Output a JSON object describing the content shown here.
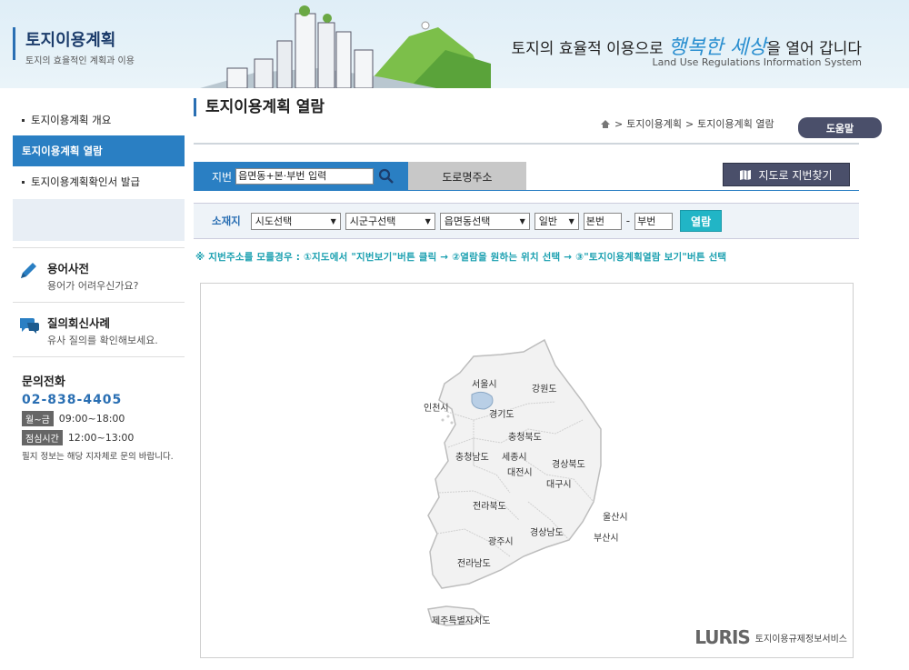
{
  "header": {
    "brand_title": "토지이용계획",
    "brand_sub": "토지의 효율적인 계획과 이용",
    "slogan_pre": "토지의 효율적 이용으로 ",
    "slogan_hl": "행복한 세상",
    "slogan_post": "을 열어 갑니다",
    "slogan_en": "Land Use Regulations Information System"
  },
  "sidebar": {
    "items": [
      {
        "label": "토지이용계획 개요"
      },
      {
        "label": "토지이용계획 열람"
      },
      {
        "label": "토지이용계획확인서 발급"
      }
    ],
    "dictionary": {
      "title": "용어사전",
      "sub": "용어가 어려우신가요?"
    },
    "qa": {
      "title": "질의회신사례",
      "sub": "유사 질의를 확인해보세요."
    },
    "contact": {
      "label": "문의전화",
      "phone": "02-838-4405",
      "weekday_tag": "월~금",
      "weekday_time": "09:00~18:00",
      "lunch_tag": "점심시간",
      "lunch_time": "12:00~13:00",
      "note": "필지 정보는 해당 지자체로 문의 바랍니다."
    }
  },
  "main": {
    "title": "토지이용계획 열람",
    "breadcrumb": [
      "토지이용계획",
      "토지이용계획 열람"
    ],
    "help": "도움말",
    "tab_jibun": "지번",
    "jibun_placeholder": "읍면동+본·부번 입력",
    "tab_road": "도로명주소",
    "map_find": "지도로 지번찾기",
    "filter": {
      "label": "소재지",
      "sido": "시도선택",
      "sigungu": "시군구선택",
      "eupmyeon": "읍면동선택",
      "type": "일반",
      "bonbun": "본번",
      "dash": "-",
      "bubun": "부번",
      "view": "열람"
    },
    "guide": "※ 지번주소를 모를경우 : ①지도에서 \"지번보기\"버튼 클릭 → ②열람을 원하는 위치 선택 → ③\"토지이용계획열람 보기\"버튼 선택",
    "map": {
      "regions": [
        "서울시",
        "강원도",
        "인천시",
        "경기도",
        "충청북도",
        "충청남도",
        "세종시",
        "대전시",
        "경상북도",
        "대구시",
        "전라북도",
        "울산시",
        "광주시",
        "경상남도",
        "부산시",
        "전라남도",
        "제주특별자치도"
      ],
      "logo": "LURIS",
      "service": "토지이용규제정보서비스"
    }
  },
  "colors": {
    "primary": "#2a7fc3",
    "dark_button": "#4a4f6a",
    "teal": "#21b5c6"
  }
}
